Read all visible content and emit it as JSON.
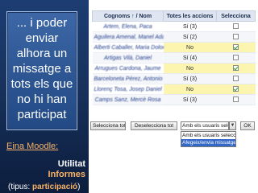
{
  "left": {
    "callout_text": "... i poder\nenviar\nalhora un\nmissatge a\ntots els que\nno hi han\nparticipat",
    "eina_label": "Eina Moodle:",
    "utilitat": "Utilitat",
    "informes": "Informes",
    "tipus_prefix": "(tipus: ",
    "tipus_value": "participació",
    "tipus_suffix": ")"
  },
  "table": {
    "headers": {
      "name": "Cognoms ↑ / Nom",
      "actions": "Totes les accions",
      "select": "Selecciona"
    },
    "rows": [
      {
        "name": "Artem, Elena, Paca",
        "actions": "Sí (3)",
        "checked": false,
        "no": false
      },
      {
        "name": "Aguilera Amenal, Manel Ada",
        "actions": "Sí (2)",
        "checked": false,
        "no": false
      },
      {
        "name": "Alberti Caballer, Maria Dolores",
        "actions": "No",
        "checked": true,
        "no": true
      },
      {
        "name": "Artigas Vilà, Daniel",
        "actions": "Sí (4)",
        "checked": false,
        "no": false
      },
      {
        "name": "Arrugues Cardona, Jaume",
        "actions": "No",
        "checked": true,
        "no": true
      },
      {
        "name": "Barceloneta Pérez, Antonio",
        "actions": "Sí (3)",
        "checked": false,
        "no": false
      },
      {
        "name": "Llorenç Tosa, Josep Daniel",
        "actions": "No",
        "checked": true,
        "no": true
      },
      {
        "name": "Camps Sanz, Mercè Rosa",
        "actions": "Sí (3)",
        "checked": false,
        "no": false
      }
    ]
  },
  "toolbar": {
    "select_all": "Selecciona tot",
    "deselect_all": "Deselecciona tot",
    "select_value": "Amb els usuaris seleccionats",
    "ok": "OK",
    "dropdown_options": [
      "Amb els usuaris seleccionats",
      "Afegeix/envia missatge"
    ]
  }
}
